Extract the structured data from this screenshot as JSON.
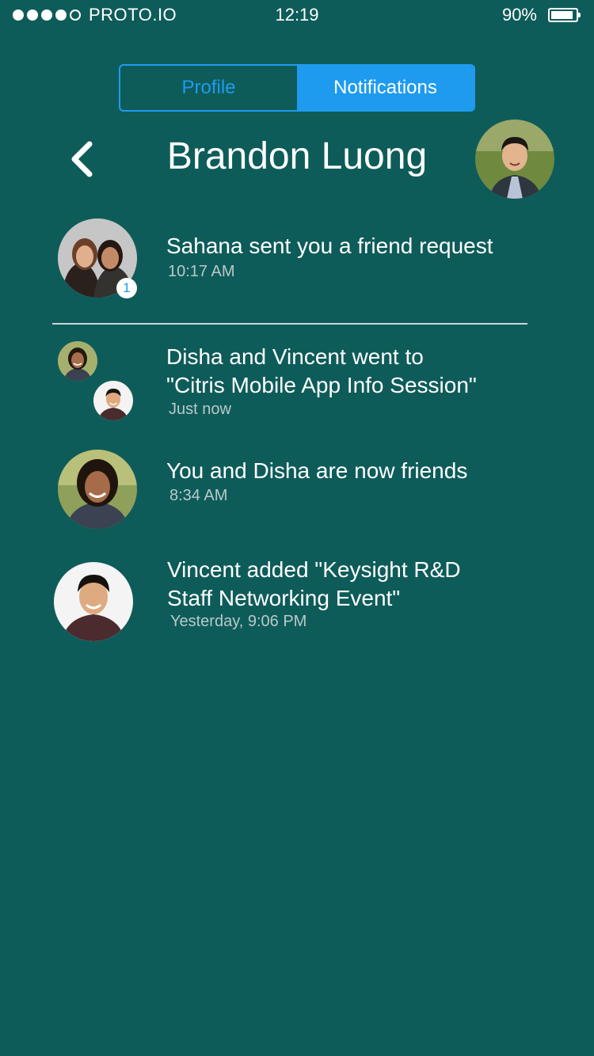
{
  "status_bar": {
    "carrier": "PROTO.IO",
    "time": "12:19",
    "battery": "90%",
    "battery_level": 0.9
  },
  "tabs": [
    {
      "label": "Profile",
      "active": false
    },
    {
      "label": "Notifications",
      "active": true
    }
  ],
  "header": {
    "title": "Brandon Luong",
    "back_icon": "chevron-left-icon"
  },
  "notifications": [
    {
      "message": "Sahana sent you a friend request",
      "time": "10:17 AM",
      "badge": "1"
    },
    {
      "message_line1": "Disha and Vincent went to",
      "message_line2": "\"Citris Mobile App Info Session\"",
      "time": "Just now"
    },
    {
      "message": "You and Disha are now friends",
      "time": "8:34 AM"
    },
    {
      "message_line1": "Vincent added \"Keysight R&D",
      "message_line2": "Staff Networking Event\"",
      "time": "Yesterday, 9:06 PM"
    }
  ],
  "colors": {
    "background": "#0e5c5a",
    "accent": "#1e9bef",
    "secondary_text": "#b8c9c8",
    "divider": "#c9d6d5"
  }
}
